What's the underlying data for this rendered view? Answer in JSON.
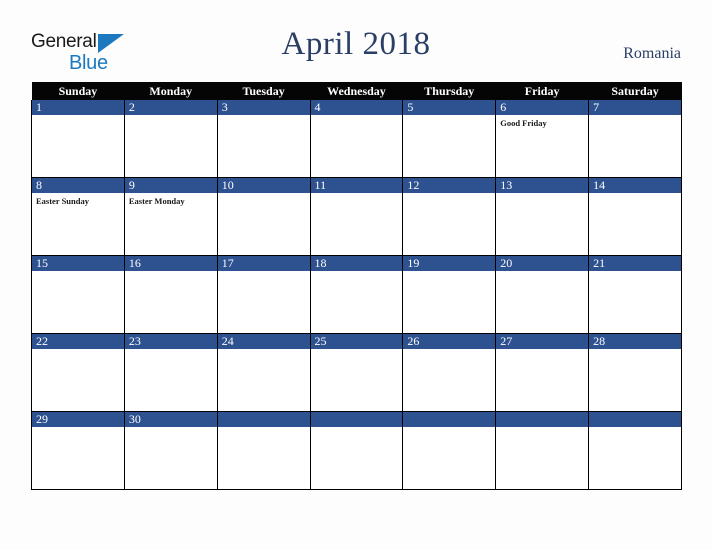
{
  "brand": {
    "name_part1": "General",
    "name_part2": "Blue",
    "triangle_icon": "triangle-icon",
    "accent_color": "#1c79c0"
  },
  "header": {
    "title": "April 2018",
    "country": "Romania",
    "title_color": "#2b3f66"
  },
  "calendar": {
    "weekday_headers": [
      "Sunday",
      "Monday",
      "Tuesday",
      "Wednesday",
      "Thursday",
      "Friday",
      "Saturday"
    ],
    "header_bg": "#050505",
    "date_bar_color": "#2e5190",
    "weeks": [
      [
        {
          "day": "1",
          "events": []
        },
        {
          "day": "2",
          "events": []
        },
        {
          "day": "3",
          "events": []
        },
        {
          "day": "4",
          "events": []
        },
        {
          "day": "5",
          "events": []
        },
        {
          "day": "6",
          "events": [
            "Good Friday"
          ]
        },
        {
          "day": "7",
          "events": []
        }
      ],
      [
        {
          "day": "8",
          "events": [
            "Easter Sunday"
          ]
        },
        {
          "day": "9",
          "events": [
            "Easter Monday"
          ]
        },
        {
          "day": "10",
          "events": []
        },
        {
          "day": "11",
          "events": []
        },
        {
          "day": "12",
          "events": []
        },
        {
          "day": "13",
          "events": []
        },
        {
          "day": "14",
          "events": []
        }
      ],
      [
        {
          "day": "15",
          "events": []
        },
        {
          "day": "16",
          "events": []
        },
        {
          "day": "17",
          "events": []
        },
        {
          "day": "18",
          "events": []
        },
        {
          "day": "19",
          "events": []
        },
        {
          "day": "20",
          "events": []
        },
        {
          "day": "21",
          "events": []
        }
      ],
      [
        {
          "day": "22",
          "events": []
        },
        {
          "day": "23",
          "events": []
        },
        {
          "day": "24",
          "events": []
        },
        {
          "day": "25",
          "events": []
        },
        {
          "day": "26",
          "events": []
        },
        {
          "day": "27",
          "events": []
        },
        {
          "day": "28",
          "events": []
        }
      ],
      [
        {
          "day": "29",
          "events": []
        },
        {
          "day": "30",
          "events": []
        },
        {
          "day": "",
          "events": []
        },
        {
          "day": "",
          "events": []
        },
        {
          "day": "",
          "events": []
        },
        {
          "day": "",
          "events": []
        },
        {
          "day": "",
          "events": []
        }
      ]
    ]
  }
}
